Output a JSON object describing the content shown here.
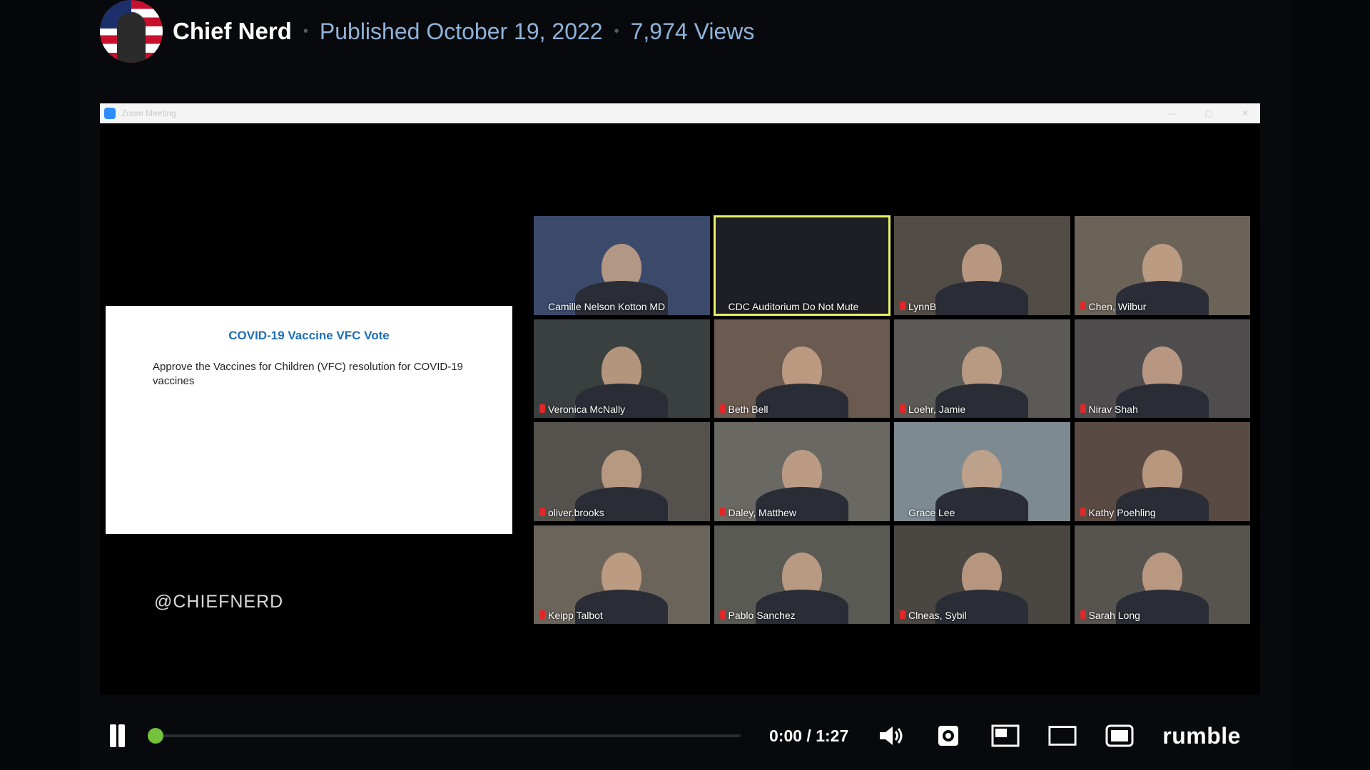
{
  "header": {
    "channel_name": "Chief Nerd",
    "published": "Published October 19, 2022",
    "views": "7,974 Views"
  },
  "zoom": {
    "title": "Zoom Meeting"
  },
  "slide": {
    "title": "COVID-19 Vaccine VFC Vote",
    "text": "Approve the Vaccines for Children (VFC) resolution for COVID-19 vaccines"
  },
  "watermark": "@CHIEFNERD",
  "participants": [
    {
      "name": "Camille Nelson Kotton MD"
    },
    {
      "name": "CDC Auditorium Do Not Mute"
    },
    {
      "name": "LynnB"
    },
    {
      "name": "Chen, Wilbur"
    },
    {
      "name": "Veronica McNally"
    },
    {
      "name": "Beth Bell"
    },
    {
      "name": "Loehr, Jamie"
    },
    {
      "name": "Nirav Shah"
    },
    {
      "name": "oliver.brooks"
    },
    {
      "name": "Daley, Matthew"
    },
    {
      "name": "Grace Lee"
    },
    {
      "name": "Kathy Poehling"
    },
    {
      "name": "Keipp Talbot"
    },
    {
      "name": "Pablo Sanchez"
    },
    {
      "name": "Clneas, Sybil"
    },
    {
      "name": "Sarah Long"
    }
  ],
  "player": {
    "time": "0:00 / 1:27",
    "progress": 0.0,
    "brand": "rumble",
    "accent": "#74c13b",
    "icons": [
      "pause-icon",
      "volume-icon",
      "settings-icon",
      "pip-icon",
      "theater-icon",
      "fullscreen-icon"
    ]
  }
}
